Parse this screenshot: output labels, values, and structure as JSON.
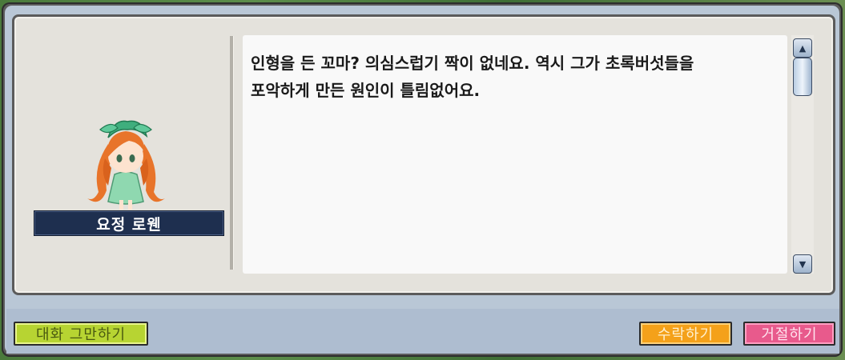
{
  "npc": {
    "name": "요정 로웬"
  },
  "dialog": {
    "text": "인형을 든 꼬마? 의심스럽기 짝이 없네요. 역시 그가 초록버섯들을\n포악하게 만든 원인이 틀림없어요."
  },
  "buttons": {
    "end_chat": "대화 그만하기",
    "accept": "수락하기",
    "decline": "거절하기"
  },
  "colors": {
    "end_chat_bg": "#b7d432",
    "accept_bg": "#f4a11a",
    "decline_bg": "#e85a8c",
    "name_plate_bg": "#1e2f4f"
  },
  "icons": {
    "scroll_up": "scroll-up-arrow-icon",
    "scroll_down": "scroll-down-arrow-icon"
  }
}
